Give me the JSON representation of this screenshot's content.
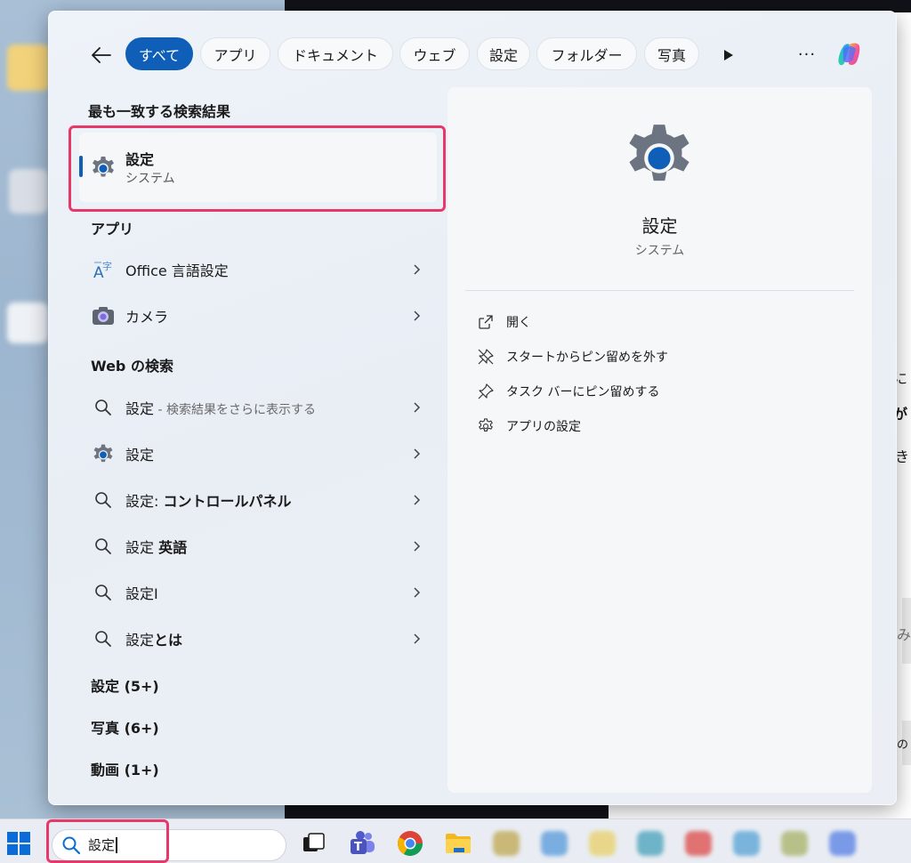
{
  "filters": {
    "items": [
      "すべて",
      "アプリ",
      "ドキュメント",
      "ウェブ",
      "設定",
      "フォルダー",
      "写真"
    ],
    "active": "すべて",
    "more_label": "···"
  },
  "best_match": {
    "section_title": "最も一致する検索結果",
    "title": "設定",
    "subtitle": "システム"
  },
  "apps": {
    "section_title": "アプリ",
    "items": [
      {
        "label": "Office 言語設定",
        "icon": "language-settings-icon"
      },
      {
        "label": "カメラ",
        "icon": "camera-icon"
      }
    ]
  },
  "web": {
    "section_title": "Web の検索",
    "items": [
      {
        "prefix": "設定",
        "bold": "",
        "sub": " - 検索結果をさらに表示する"
      },
      {
        "prefix": "設定",
        "bold": "",
        "sub": ""
      },
      {
        "prefix": "設定: ",
        "bold": "コントロールパネル",
        "sub": ""
      },
      {
        "prefix": "設定 ",
        "bold": "英語",
        "sub": ""
      },
      {
        "prefix": "設定I",
        "bold": "",
        "sub": ""
      },
      {
        "prefix": "設定",
        "bold": "とは",
        "sub": ""
      }
    ]
  },
  "more_sections": [
    {
      "label": "設定 (5+)"
    },
    {
      "label": "写真 (6+)"
    },
    {
      "label": "動画 (1+)"
    }
  ],
  "detail": {
    "title": "設定",
    "subtitle": "システム",
    "actions": [
      {
        "label": "開く",
        "icon": "open-external-icon"
      },
      {
        "label": "スタートからピン留めを外す",
        "icon": "unpin-icon"
      },
      {
        "label": "タスク バーにピン留めする",
        "icon": "pin-icon"
      },
      {
        "label": "アプリの設定",
        "icon": "gear-icon"
      }
    ]
  },
  "taskbar": {
    "search_value": "設定"
  },
  "background_fragments": {
    "a": "に",
    "b": "が",
    "c": "き",
    "d": "み",
    "e": "の"
  },
  "colors": {
    "accent": "#0f5fb8",
    "highlight": "#e8386a"
  }
}
